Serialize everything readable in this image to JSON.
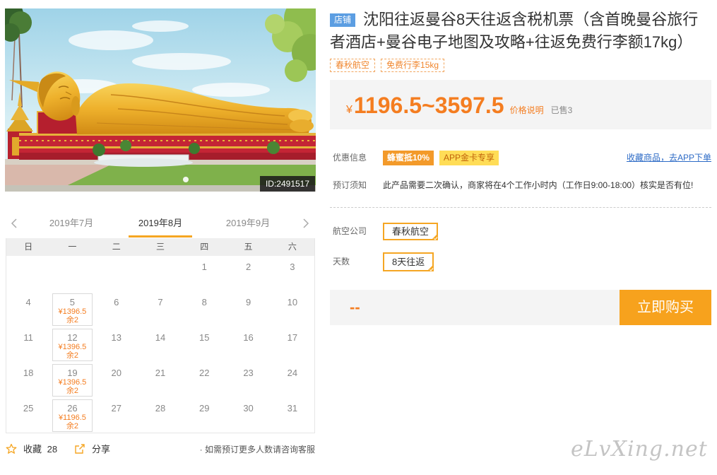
{
  "theme": {
    "accent": "#f47d20",
    "button": "#f7a21d",
    "selected_border": "#f5a623",
    "shop_badge": "#5c9ee2",
    "link": "#2d6bc6",
    "promo_orange": "#f39a2a",
    "promo_yellow": "#ffdd57"
  },
  "product": {
    "shop_badge": "店铺",
    "title": "沈阳往返曼谷8天往返含税机票（含首晚曼谷旅行者酒店+曼谷电子地图及攻略+往返免费行李额17kg）",
    "tags": [
      "春秋航空",
      "免费行李15kg"
    ],
    "image_id": "ID:2491517"
  },
  "price": {
    "currency": "¥",
    "range": "1196.5~3597.5",
    "note_link": "价格说明",
    "sold": "已售3"
  },
  "promo": {
    "label": "优惠信息",
    "badges": [
      "蜂蜜抵10%",
      "APP金卡专享"
    ],
    "app_link": "收藏商品，去APP下单"
  },
  "booking_notice": {
    "label": "预订须知",
    "text": "此产品需要二次确认，商家将在4个工作小时内（工作日9:00-18:00）核实是否有位!"
  },
  "options": [
    {
      "label": "航空公司",
      "selected": "春秋航空"
    },
    {
      "label": "天数",
      "selected": "8天往返"
    }
  ],
  "buy": {
    "total": "--",
    "button": "立即购买"
  },
  "calendar": {
    "months": [
      "2019年7月",
      "2019年8月",
      "2019年9月"
    ],
    "active_month_index": 1,
    "weekdays": [
      "日",
      "一",
      "二",
      "三",
      "四",
      "五",
      "六"
    ],
    "weeks": [
      [
        null,
        null,
        null,
        null,
        {
          "day": "1"
        },
        {
          "day": "2"
        },
        {
          "day": "3"
        }
      ],
      [
        {
          "day": "4"
        },
        {
          "day": "5",
          "price": "¥1396.5",
          "stock": "余2"
        },
        {
          "day": "6"
        },
        {
          "day": "7"
        },
        {
          "day": "8"
        },
        {
          "day": "9"
        },
        {
          "day": "10"
        }
      ],
      [
        {
          "day": "11"
        },
        {
          "day": "12",
          "price": "¥1396.5",
          "stock": "余2"
        },
        {
          "day": "13"
        },
        {
          "day": "14"
        },
        {
          "day": "15"
        },
        {
          "day": "16"
        },
        {
          "day": "17"
        }
      ],
      [
        {
          "day": "18"
        },
        {
          "day": "19",
          "price": "¥1396.5",
          "stock": "余2"
        },
        {
          "day": "20"
        },
        {
          "day": "21"
        },
        {
          "day": "22"
        },
        {
          "day": "23"
        },
        {
          "day": "24"
        }
      ],
      [
        {
          "day": "25"
        },
        {
          "day": "26",
          "price": "¥1196.5",
          "stock": "余2"
        },
        {
          "day": "27"
        },
        {
          "day": "28"
        },
        {
          "day": "29"
        },
        {
          "day": "30"
        },
        {
          "day": "31"
        }
      ]
    ]
  },
  "footer": {
    "favorite_label": "收藏",
    "favorite_count": "28",
    "share_label": "分享",
    "note": "· 如需预订更多人数请咨询客服"
  },
  "icons": {
    "favorite": "star-icon",
    "share": "share-icon",
    "prev_month": "chevron-left-icon",
    "next_month": "chevron-right-icon",
    "selected": "check-corner-icon"
  },
  "watermark": "eLvXing.net"
}
